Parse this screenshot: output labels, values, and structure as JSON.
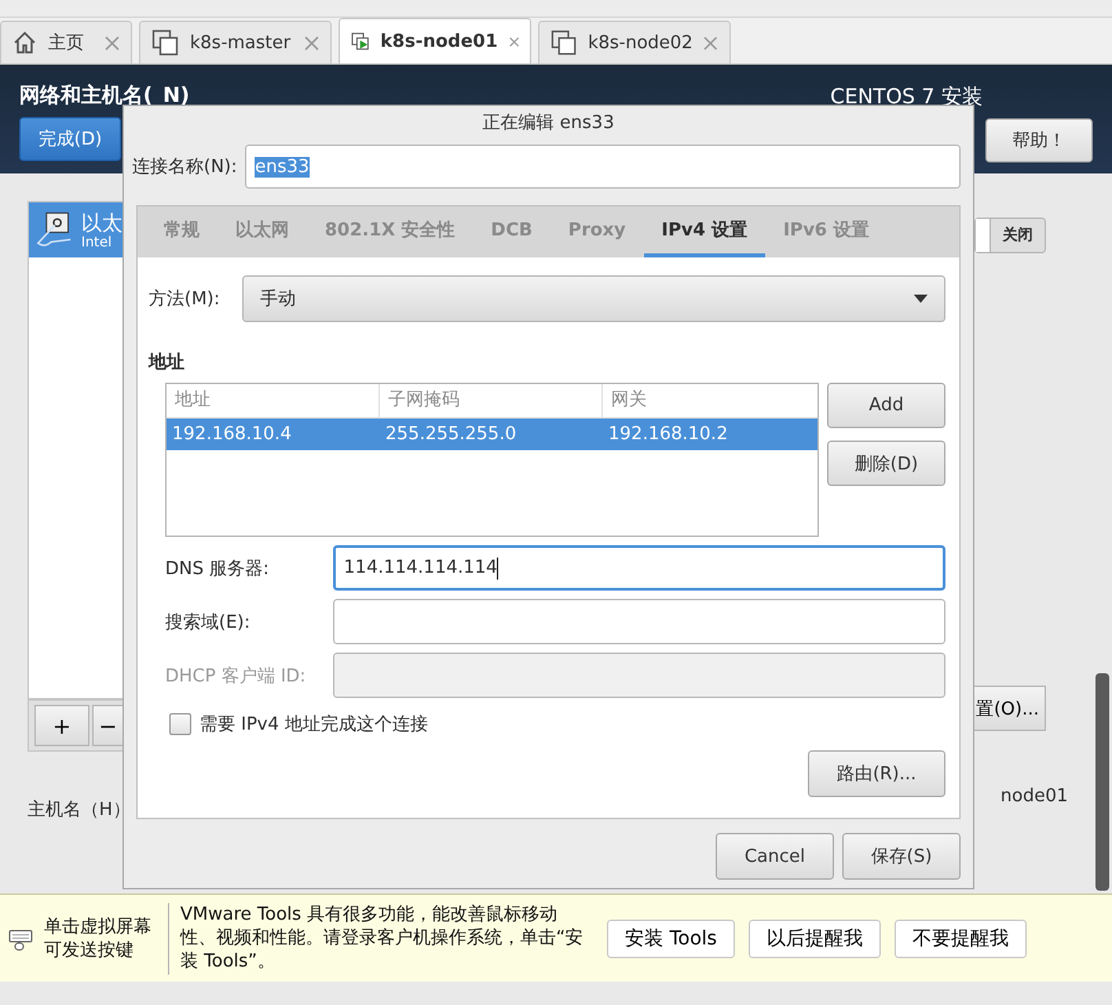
{
  "vm_tabs": [
    {
      "label": "主页",
      "kind": "home",
      "selected": false
    },
    {
      "label": "k8s-master",
      "kind": "vm",
      "selected": false
    },
    {
      "label": "k8s-node01",
      "kind": "vm-running",
      "selected": true
    },
    {
      "label": "k8s-node02",
      "kind": "vm",
      "selected": false
    }
  ],
  "installer": {
    "title": "网络和主机名(_N)",
    "product": "CENTOS 7 安装",
    "done_button": "完成(D)",
    "help_button": "帮助！",
    "device": {
      "name": "以太",
      "detail": "Intel",
      "selected": true
    },
    "switch": {
      "label": "关闭",
      "on": false
    },
    "add_button": "+",
    "remove_button": "−",
    "configure_button": "置(O)...",
    "hostname_label": "主机名（H）",
    "hostname_value": "node01"
  },
  "dialog": {
    "title": "正在编辑 ens33",
    "connection_name": {
      "label": "连接名称(N):",
      "value": "ens33"
    },
    "tabs": [
      {
        "label": "常规",
        "selected": false
      },
      {
        "label": "以太网",
        "selected": false
      },
      {
        "label": "802.1X 安全性",
        "selected": false
      },
      {
        "label": "DCB",
        "selected": false
      },
      {
        "label": "Proxy",
        "selected": false
      },
      {
        "label": "IPv4 设置",
        "selected": true
      },
      {
        "label": "IPv6 设置",
        "selected": false
      }
    ],
    "method": {
      "label": "方法(M):",
      "value": "手动"
    },
    "address_heading": "地址",
    "table": {
      "columns": [
        "地址",
        "子网掩码",
        "网关"
      ],
      "rows": [
        {
          "cells": [
            "192.168.10.4",
            "255.255.255.0",
            "192.168.10.2"
          ],
          "selected": true
        }
      ]
    },
    "add_button": "Add",
    "delete_button": "删除(D)",
    "fields": [
      {
        "label": "DNS 服务器:",
        "value": "114.114.114.114",
        "focused": true,
        "disabled": false
      },
      {
        "label": "搜索域(E):",
        "focused": false,
        "disabled": false
      },
      {
        "label": "DHCP 客户端 ID:",
        "focused": false,
        "disabled": true
      }
    ],
    "require_ipv4": {
      "label": "需要 IPv4 地址完成这个连接",
      "checked": false
    },
    "routes_button": "路由(R)...",
    "footer_buttons": [
      "Cancel",
      "保存(S)"
    ]
  },
  "notification": {
    "hint": "单击虚拟屏幕可发送按键",
    "message": "VMware Tools 具有很多功能，能改善鼠标移动性、视频和性能。请登录客户机操作系统，单击“安装 Tools”。",
    "buttons": [
      "安装 Tools",
      "以后提醒我",
      "不要提醒我"
    ]
  }
}
